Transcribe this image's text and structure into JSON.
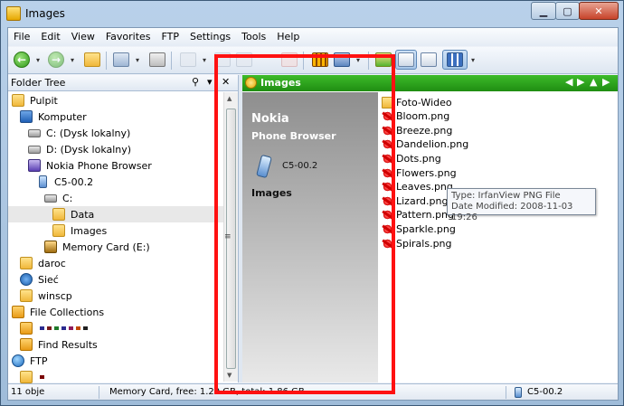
{
  "window": {
    "title": "Images"
  },
  "menu": [
    "File",
    "Edit",
    "View",
    "Favorites",
    "FTP",
    "Settings",
    "Tools",
    "Help"
  ],
  "toolbar": {
    "back_label": "←",
    "forward_label": "→",
    "dropdown_glyph": "▾"
  },
  "tree": {
    "header": "Folder Tree",
    "items": [
      {
        "label": "Pulpit",
        "icon": "folder",
        "indent": 0
      },
      {
        "label": "Komputer",
        "icon": "monitor",
        "indent": 1
      },
      {
        "label": "C: (Dysk lokalny)",
        "icon": "drive",
        "indent": 2
      },
      {
        "label": "D: (Dysk lokalny)",
        "icon": "drive",
        "indent": 2
      },
      {
        "label": "Nokia Phone Browser",
        "icon": "nokia",
        "indent": 2
      },
      {
        "label": "C5-00.2",
        "icon": "phone",
        "indent": 3
      },
      {
        "label": "C:",
        "icon": "drive",
        "indent": 4
      },
      {
        "label": "Data",
        "icon": "folder",
        "indent": 5,
        "selected": true
      },
      {
        "label": "Images",
        "icon": "folder",
        "indent": 5
      },
      {
        "label": "Memory Card (E:)",
        "icon": "card",
        "indent": 4
      },
      {
        "label": "daroc",
        "icon": "folder",
        "indent": 1
      },
      {
        "label": "Sieć",
        "icon": "net",
        "indent": 1
      },
      {
        "label": "winscp",
        "icon": "folder",
        "indent": 1
      },
      {
        "label": "File Collections",
        "icon": "collection",
        "indent": 0
      },
      {
        "label": "",
        "icon": "collection",
        "indent": 1,
        "swatches": [
          "#2b2b8f",
          "#7a1a1a",
          "#1f7a2a",
          "#2b2b8f",
          "#8f1a5b",
          "#c24a00",
          "#1f1f1f"
        ]
      },
      {
        "label": "Find Results",
        "icon": "collection",
        "indent": 1
      },
      {
        "label": "FTP",
        "icon": "globe",
        "indent": 0
      },
      {
        "label": "",
        "icon": "folder",
        "indent": 1,
        "swatches": [
          "#7a0000"
        ]
      }
    ]
  },
  "right": {
    "header": "Images",
    "info": {
      "title": "Nokia",
      "subtitle": "Phone Browser",
      "device": "C5-00.2",
      "folder": "Images"
    },
    "files": [
      {
        "name": "Foto-Wideo",
        "type": "folder"
      },
      {
        "name": "Bloom.png",
        "type": "png"
      },
      {
        "name": "Breeze.png",
        "type": "png"
      },
      {
        "name": "Dandelion.png",
        "type": "png"
      },
      {
        "name": "Dots.png",
        "type": "png"
      },
      {
        "name": "Flowers.png",
        "type": "png"
      },
      {
        "name": "Leaves.png",
        "type": "png"
      },
      {
        "name": "Lizard.png",
        "type": "png"
      },
      {
        "name": "Pattern.png",
        "type": "png"
      },
      {
        "name": "Sparkle.png",
        "type": "png"
      },
      {
        "name": "Spirals.png",
        "type": "png"
      }
    ],
    "tooltip": {
      "type_line": "Type: IrfanView PNG File",
      "date_line": "Date Modified: 2008-11-03 19:26"
    }
  },
  "status": {
    "count": "11 obje",
    "memory": "Memory Card, free: 1.29 GB, total: 1.86 GB",
    "device": "C5-00.2"
  },
  "highlight_color": "#ff1111"
}
